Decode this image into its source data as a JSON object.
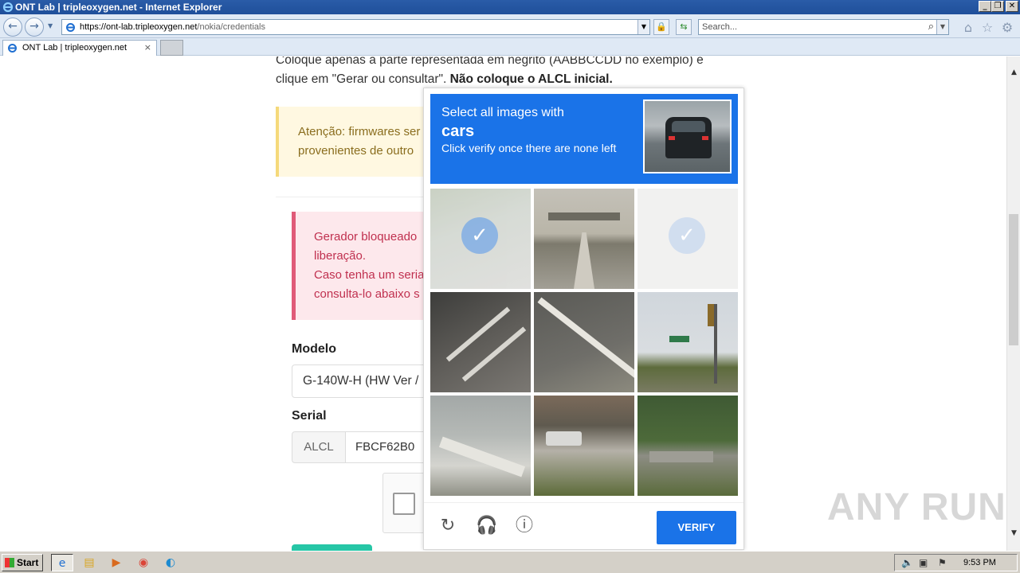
{
  "browser": {
    "window_title": "ONT Lab | tripleoxygen.net - Internet Explorer",
    "address": {
      "prefix": "https://ont-lab.",
      "domain": "tripleoxygen.net",
      "path": "/nokia/credentials"
    },
    "search_placeholder": "Search...",
    "tab_title": "ONT Lab | tripleoxygen.net",
    "tab_close": "×"
  },
  "page": {
    "instruction_part1": "Coloque apenas a parte representada em negrito (AABBCCDD no exemplo) e clique em \"Gerar ou consultar\". ",
    "instruction_bold": "Não coloque o ALCL inicial.",
    "warning_line1": "Atenção: firmwares ser",
    "warning_line2": "provenientes de outro",
    "blocked_line1": "Gerador bloqueado",
    "blocked_line2": "liberação.",
    "blocked_line3": "Caso tenha um seria",
    "blocked_line4": "consulta-lo abaixo s",
    "modelo_label": "Modelo",
    "modelo_value": "G-140W-H (HW Ver /",
    "serial_label": "Serial",
    "serial_prefix": "ALCL",
    "serial_value": "FBCF62B0"
  },
  "captcha": {
    "prompt_line1": "Select all images with",
    "target": "cars",
    "prompt_line3": "Click verify once there are none left",
    "verify_label": "VERIFY",
    "tiles": [
      {
        "name": "tile-1",
        "selected": true
      },
      {
        "name": "tile-2",
        "selected": false
      },
      {
        "name": "tile-3",
        "selected": true
      },
      {
        "name": "tile-4",
        "selected": false
      },
      {
        "name": "tile-5",
        "selected": false
      },
      {
        "name": "tile-6",
        "selected": false
      },
      {
        "name": "tile-7",
        "selected": false
      },
      {
        "name": "tile-8",
        "selected": false
      },
      {
        "name": "tile-9",
        "selected": false
      }
    ]
  },
  "taskbar": {
    "start_label": "Start",
    "clock": "9:53 PM"
  },
  "watermark": "ANY RUN"
}
